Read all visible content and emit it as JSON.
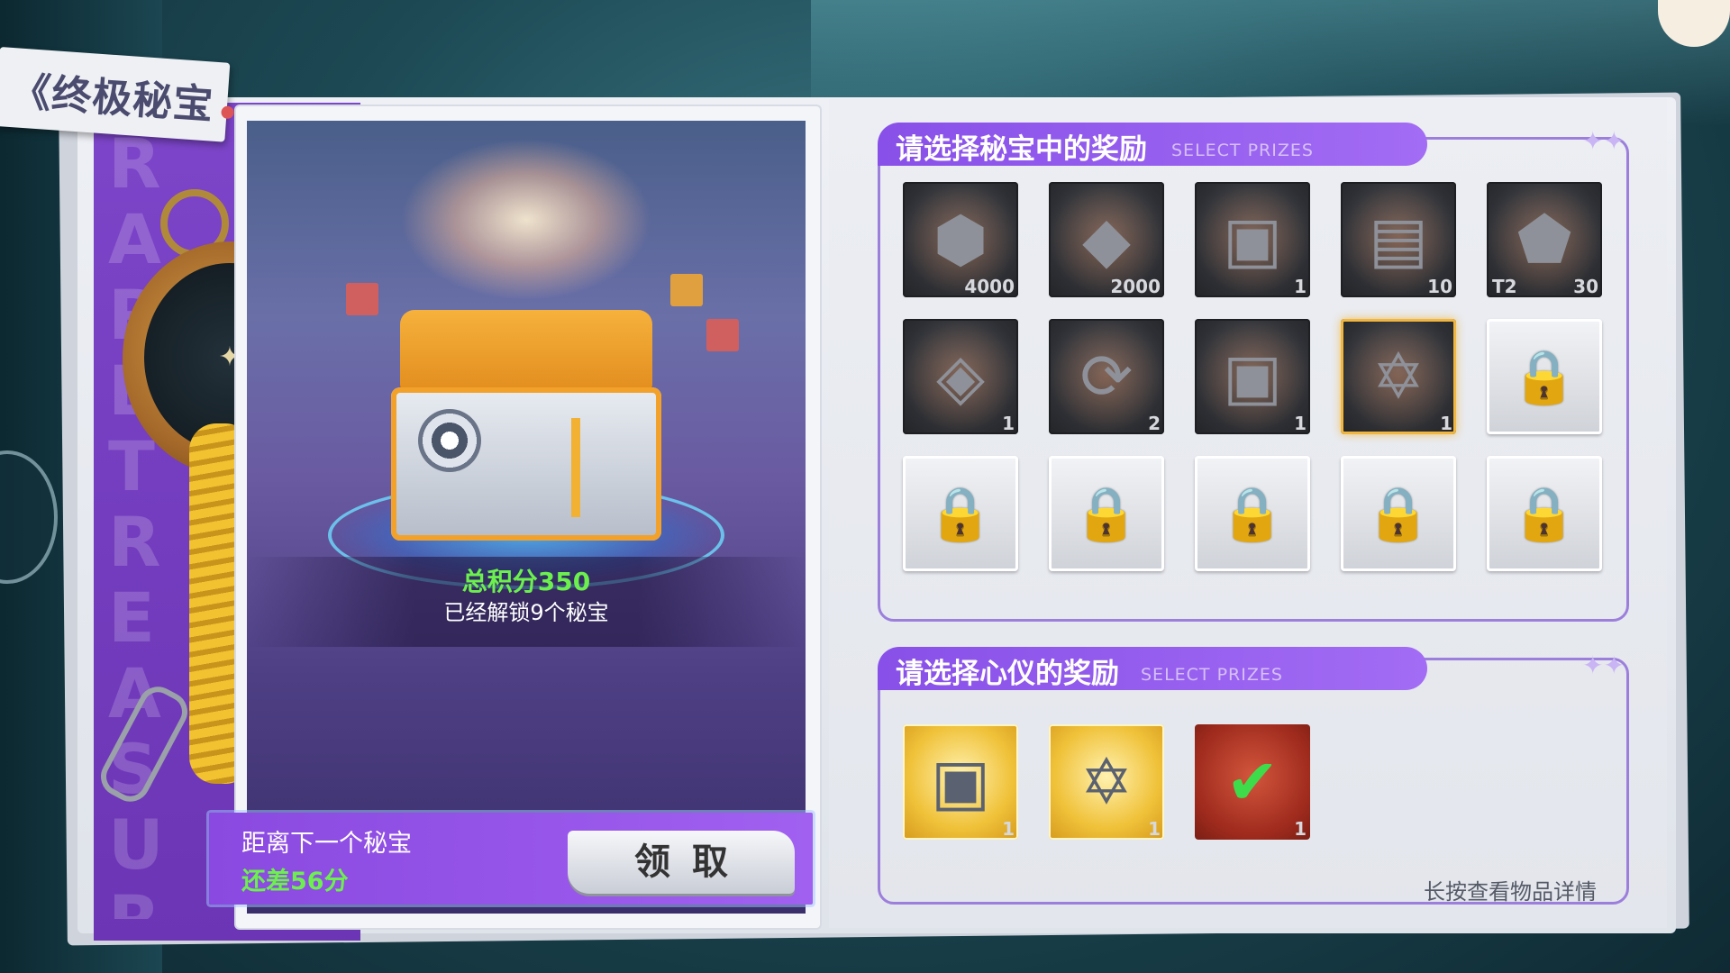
{
  "title": "《终极秘宝",
  "spine_text": "RARE TREASURE RARE TREASURE",
  "main": {
    "total_score": "总积分350",
    "unlocked_text": "已经解锁9个秘宝",
    "next_label": "距离下一个秘宝",
    "next_points": "还差56分",
    "claim_label": "领取"
  },
  "section1": {
    "title_cn": "请选择秘宝中的奖励",
    "title_en": "SELECT PRIZES",
    "items": [
      {
        "icon": "coin-icon",
        "glyph": "⬢",
        "qty": "4000",
        "state": "dark"
      },
      {
        "icon": "diamond-icon",
        "glyph": "◆",
        "qty": "2000",
        "state": "dark"
      },
      {
        "icon": "chest-icon",
        "glyph": "▣",
        "qty": "1",
        "state": "dark"
      },
      {
        "icon": "device-box-icon",
        "glyph": "▤",
        "qty": "10",
        "state": "dark"
      },
      {
        "icon": "gem-emblem-icon",
        "glyph": "⬟",
        "qty": "30",
        "tier": "T2",
        "state": "dark"
      },
      {
        "icon": "ore-icon",
        "glyph": "◈",
        "qty": "1",
        "state": "dark"
      },
      {
        "icon": "scroll-icon",
        "glyph": "⟳",
        "qty": "2",
        "state": "dark"
      },
      {
        "icon": "chest-icon",
        "glyph": "▣",
        "qty": "1",
        "state": "dark"
      },
      {
        "icon": "star-plate-icon",
        "glyph": "✡",
        "qty": "1",
        "state": "selected"
      },
      {
        "icon": "lock-icon",
        "glyph": "🔒",
        "qty": "",
        "state": "locked"
      },
      {
        "icon": "lock-icon",
        "glyph": "🔒",
        "qty": "",
        "state": "locked"
      },
      {
        "icon": "lock-icon",
        "glyph": "🔒",
        "qty": "",
        "state": "locked"
      },
      {
        "icon": "lock-icon",
        "glyph": "🔒",
        "qty": "",
        "state": "locked"
      },
      {
        "icon": "lock-icon",
        "glyph": "🔒",
        "qty": "",
        "state": "locked"
      },
      {
        "icon": "lock-icon",
        "glyph": "🔒",
        "qty": "",
        "state": "locked"
      }
    ]
  },
  "section2": {
    "title_cn": "请选择心仪的奖励",
    "title_en": "SELECT PRIZES",
    "items": [
      {
        "icon": "gold-chest-icon",
        "glyph": "▣",
        "qty": "1",
        "state": "gold"
      },
      {
        "icon": "gold-star-plate-icon",
        "glyph": "✡",
        "qty": "1",
        "state": "gold"
      },
      {
        "icon": "green-check-icon",
        "glyph": "✔",
        "qty": "1",
        "state": "red"
      }
    ]
  },
  "hint": "长按查看物品详情",
  "colors": {
    "accent": "#8850e8",
    "green": "#6cf04e",
    "gold": "#f0b640"
  }
}
